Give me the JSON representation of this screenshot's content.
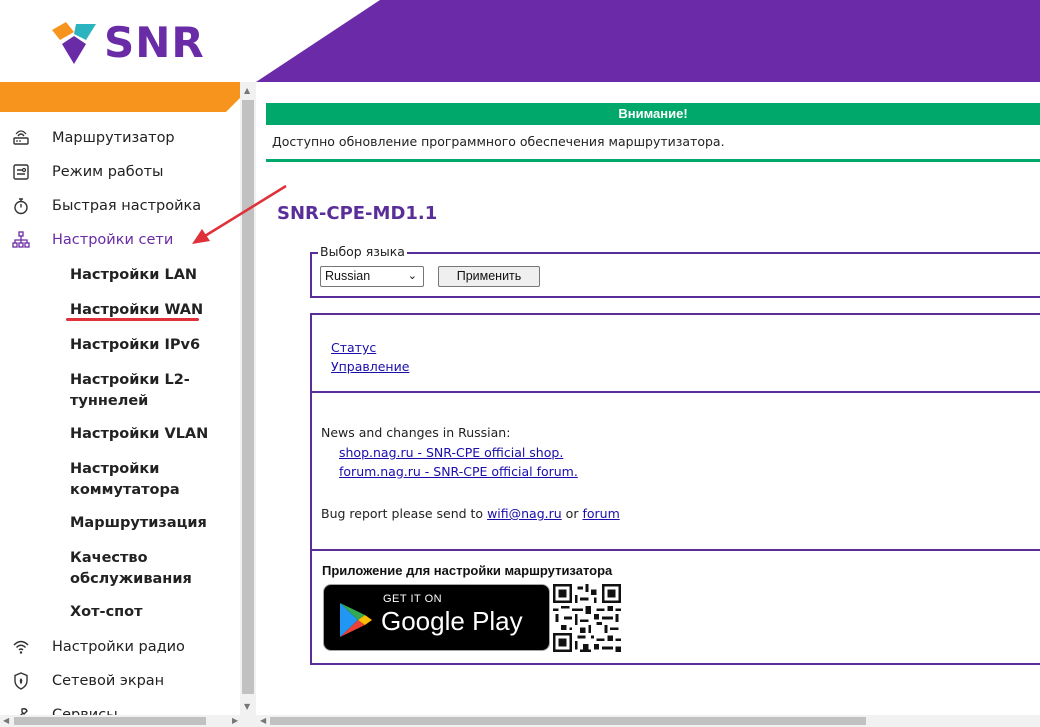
{
  "brand": {
    "name": "SNR",
    "purple": "#6a2ba6",
    "orange": "#f7941d",
    "header_purple": "#6b2aa8"
  },
  "sidebar": {
    "items": [
      {
        "label": "Маршрутизатор",
        "icon": "router-icon"
      },
      {
        "label": "Режим работы",
        "icon": "mode-icon"
      },
      {
        "label": "Быстрая настройка",
        "icon": "stopwatch-icon"
      },
      {
        "label": "Настройки сети",
        "icon": "network-icon"
      },
      {
        "label": "Настройки радио",
        "icon": "wifi-icon"
      },
      {
        "label": "Сетевой экран",
        "icon": "firewall-icon"
      },
      {
        "label": "Сервисы",
        "icon": "services-icon"
      }
    ],
    "subitems": [
      {
        "label": "Настройки LAN"
      },
      {
        "label": "Настройки WAN"
      },
      {
        "label": "Настройки IPv6"
      },
      {
        "label": "Настройки L2-туннелей"
      },
      {
        "label": "Настройки VLAN"
      },
      {
        "label": "Настройки коммутатора"
      },
      {
        "label": "Маршрутизация"
      },
      {
        "label": "Качество обслуживания"
      },
      {
        "label": "Хот-спот"
      }
    ]
  },
  "alert": {
    "title": "Внимание!",
    "message": "Доступно обновление программного обеспечения маршрутизатора.",
    "color": "#00a96b"
  },
  "main": {
    "title": "SNR-CPE-MD1.1",
    "language": {
      "legend": "Выбор языка",
      "selected": "Russian",
      "apply_label": "Применить"
    },
    "links": {
      "status": "Статус",
      "management": "Управление"
    },
    "news": {
      "heading": "News and changes in Russian:",
      "shop": "shop.nag.ru - SNR-CPE official shop.",
      "forum": "forum.nag.ru - SNR-CPE official forum."
    },
    "bug": {
      "prefix": "Bug report please send to",
      "email": "wifi@nag.ru",
      "or": "or",
      "forum": "forum"
    },
    "app": {
      "title": "Приложение для настройки маршрутизатора",
      "get_it_on": "GET IT ON",
      "store": "Google Play"
    }
  }
}
